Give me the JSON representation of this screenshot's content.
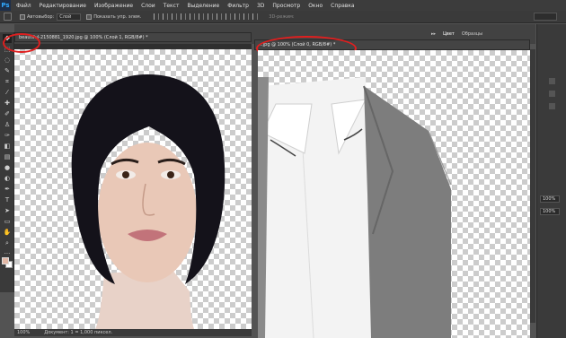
{
  "app": {
    "logo": "Ps"
  },
  "menu": [
    "Файл",
    "Редактирование",
    "Изображение",
    "Слои",
    "Текст",
    "Выделение",
    "Фильтр",
    "3D",
    "Просмотр",
    "Окно",
    "Справка"
  ],
  "options": {
    "autoselect_label": "Автовыбор:",
    "autoselect_value": "Слой",
    "show_transform_label": "Показать упр. элем.",
    "mode_3d_label": "3D-режим:"
  },
  "documents": [
    {
      "tab": "beautiful-2150881_1920.jpg @ 100% (Слой 1, RGB/8#) *",
      "status_zoom": "100%",
      "status_info": "Документ: 1 = 1,000 пиксел."
    },
    {
      "tab": "...jpg @ 100% (Слой 0, RGB/8#) *"
    }
  ],
  "panels": {
    "tabs": [
      "Цвет",
      "Образцы"
    ],
    "opacity_value": "100%",
    "fill_value": "100%"
  },
  "tools": [
    "move-tool",
    "marquee-tool",
    "lasso-tool",
    "quick-select-tool",
    "crop-tool",
    "eyedropper-tool",
    "healing-tool",
    "brush-tool",
    "stamp-tool",
    "history-brush-tool",
    "eraser-tool",
    "gradient-tool",
    "blur-tool",
    "dodge-tool",
    "pen-tool",
    "type-tool",
    "path-select-tool",
    "rectangle-tool",
    "hand-tool",
    "zoom-tool"
  ]
}
